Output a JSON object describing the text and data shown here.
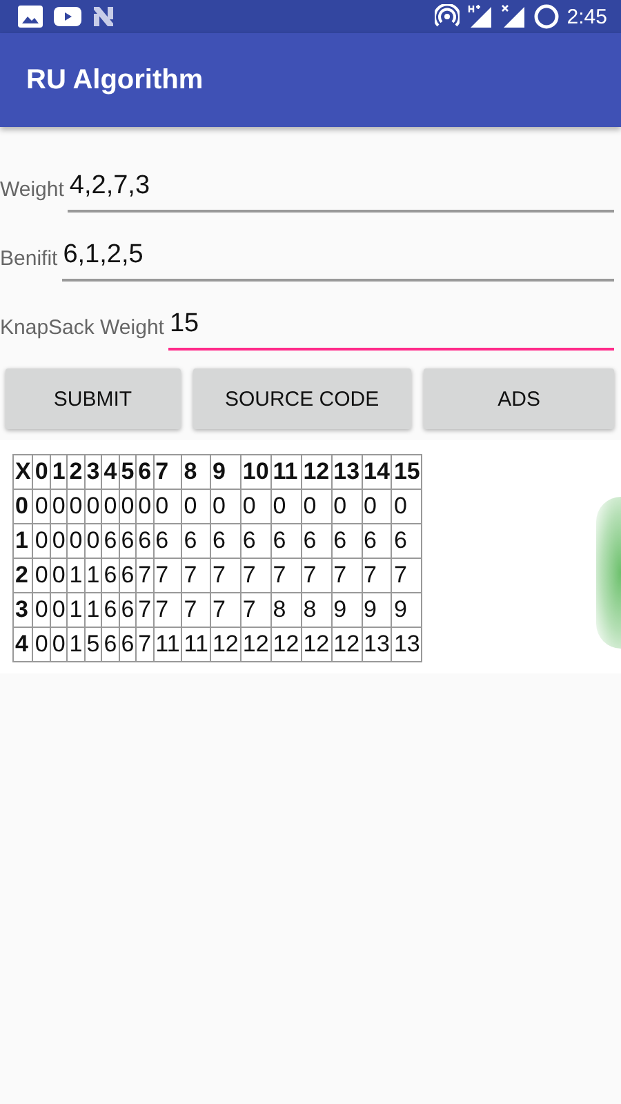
{
  "status_bar": {
    "time": "2:45"
  },
  "app_bar": {
    "title": "RU Algorithm"
  },
  "fields": [
    {
      "label": "Weight",
      "value": "4,2,7,3",
      "focused": false
    },
    {
      "label": "Benifit",
      "value": "6,1,2,5",
      "focused": false
    },
    {
      "label": "KnapSack Weight",
      "value": "15",
      "focused": true
    }
  ],
  "buttons": [
    "SUBMIT",
    "SOURCE CODE",
    "ADS"
  ],
  "table": {
    "columns": [
      "X",
      "0",
      "1",
      "2",
      "3",
      "4",
      "5",
      "6",
      "7",
      "8",
      "9",
      "10",
      "11",
      "12",
      "13",
      "14",
      "15"
    ],
    "rows": [
      [
        "0",
        "0",
        "0",
        "0",
        "0",
        "0",
        "0",
        "0",
        "0",
        "0",
        "0",
        "0",
        "0",
        "0",
        "0",
        "0",
        "0"
      ],
      [
        "1",
        "0",
        "0",
        "0",
        "0",
        "6",
        "6",
        "6",
        "6",
        "6",
        "6",
        "6",
        "6",
        "6",
        "6",
        "6",
        "6"
      ],
      [
        "2",
        "0",
        "0",
        "1",
        "1",
        "6",
        "6",
        "7",
        "7",
        "7",
        "7",
        "7",
        "7",
        "7",
        "7",
        "7",
        "7"
      ],
      [
        "3",
        "0",
        "0",
        "1",
        "1",
        "6",
        "6",
        "7",
        "7",
        "7",
        "7",
        "7",
        "8",
        "8",
        "9",
        "9",
        "9"
      ],
      [
        "4",
        "0",
        "0",
        "1",
        "5",
        "6",
        "6",
        "7",
        "11",
        "11",
        "12",
        "12",
        "12",
        "12",
        "12",
        "13",
        "13"
      ]
    ]
  }
}
